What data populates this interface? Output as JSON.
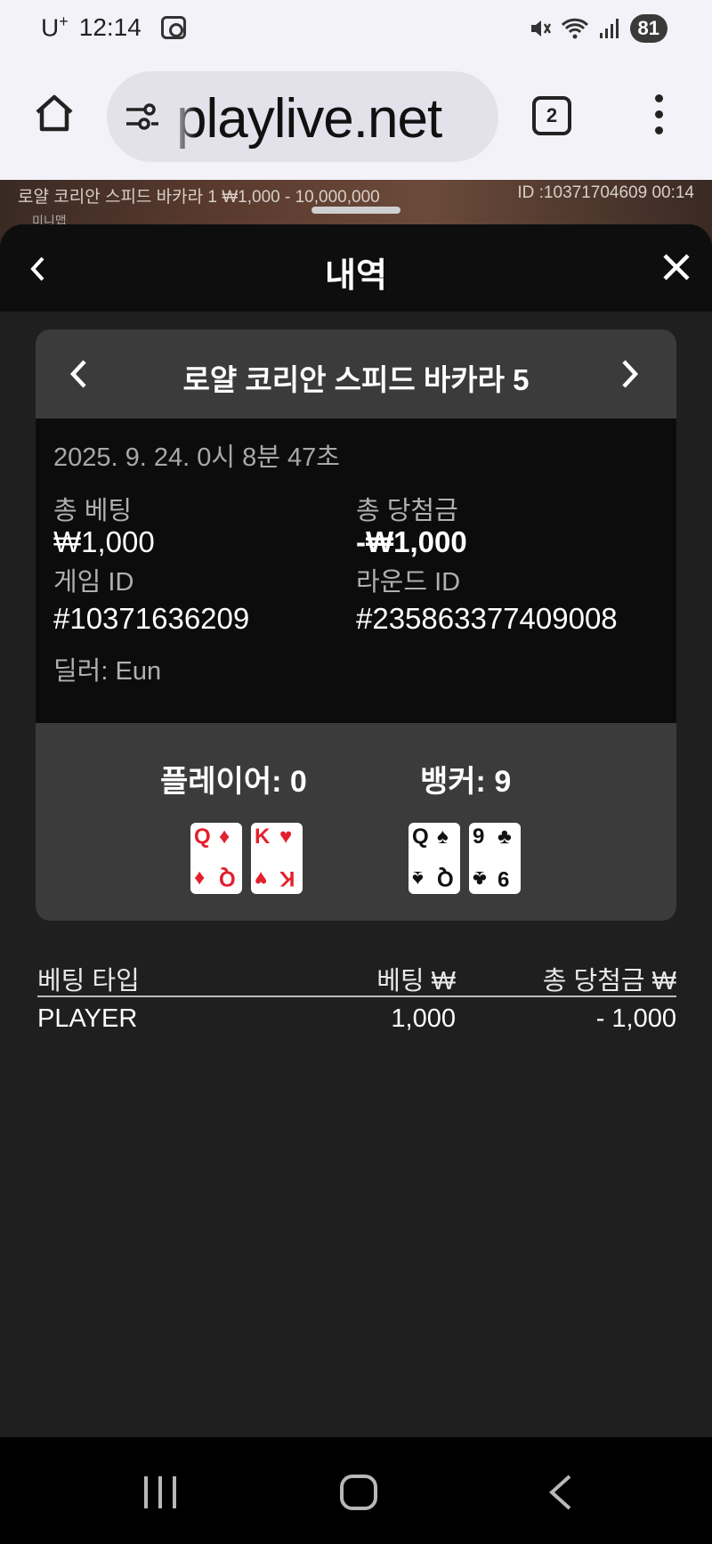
{
  "status_bar": {
    "carrier": "U",
    "carrier_plus": "+",
    "time": "12:14",
    "battery": "81"
  },
  "browser": {
    "url": "playlive.net",
    "tab_count": "2"
  },
  "video": {
    "info": "로얄 코리안 스피드 바카라 1 ₩1,000 - 10,000,000",
    "id": "ID :10371704609 00:14",
    "sub": "미니맵"
  },
  "sheet": {
    "title": "내역"
  },
  "card": {
    "title": "로얄 코리안 스피드 바카라 5",
    "timestamp": "2025. 9. 24. 0시 8분 47초",
    "total_bet_label": "총 베팅",
    "total_bet_value": "₩1,000",
    "total_win_label": "총 당첨금",
    "total_win_value": "-₩1,000",
    "game_id_label": "게임 ID",
    "game_id_value": "#10371636209",
    "round_id_label": "라운드 ID",
    "round_id_value": "#235863377409008",
    "dealer": "딜러: Eun",
    "player_label": "플레이어: 0",
    "banker_label": "뱅커: 9",
    "player_cards": [
      {
        "rank": "Q",
        "suit": "♦",
        "color": "#e3202e"
      },
      {
        "rank": "K",
        "suit": "♥",
        "color": "#e3202e"
      }
    ],
    "banker_cards": [
      {
        "rank": "Q",
        "suit": "♠",
        "color": "#111111"
      },
      {
        "rank": "9",
        "suit": "♣",
        "color": "#111111"
      }
    ]
  },
  "bets": {
    "headers": [
      "베팅 타입",
      "베팅 ₩",
      "총 당첨금 ₩"
    ],
    "rows": [
      [
        "PLAYER",
        "1,000",
        "- 1,000"
      ]
    ]
  }
}
